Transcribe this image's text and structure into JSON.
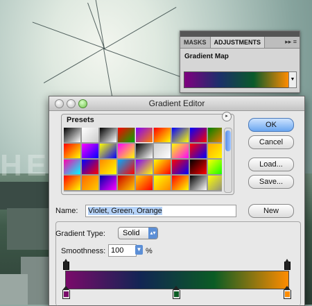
{
  "background": {
    "letters": "HE"
  },
  "adjustments_panel": {
    "tabs": [
      {
        "label": "MASKS",
        "active": false
      },
      {
        "label": "ADJUSTMENTS",
        "active": true
      }
    ],
    "tab_controls": "▸▸ ≡",
    "title": "Gradient Map",
    "gradient": [
      "#800080",
      "#1c2f6b",
      "#0a5a2a",
      "#ff8c00"
    ]
  },
  "dialog": {
    "title": "Gradient Editor",
    "presets": {
      "label": "Presets",
      "swatches": [
        [
          "#000000",
          "#ffffff"
        ],
        [
          "#ffffff",
          "#cccccc"
        ],
        [
          "#000000",
          "#ffffff"
        ],
        [
          "#ff0000",
          "#00aa00"
        ],
        [
          "#8000ff",
          "#ff8000"
        ],
        [
          "#ff0000",
          "#ffff00"
        ],
        [
          "#0000ff",
          "#ffff00"
        ],
        [
          "#0000ff",
          "#ff0000"
        ],
        [
          "#008000",
          "#ff8000"
        ],
        [
          "#ff0000",
          "#ffff00"
        ],
        [
          "#ff00ff",
          "#0000ff"
        ],
        [
          "#ffff00",
          "#0000ff"
        ],
        [
          "#ff00ff",
          "#ffff00"
        ],
        [
          "#000000",
          "#ffffff"
        ],
        [
          "#cccccc",
          "#ffffff"
        ],
        [
          "#ffff00",
          "#ff00ff"
        ],
        [
          "#ff0000",
          "#0000ff"
        ],
        [
          "#ffaa00",
          "#ffff00"
        ],
        [
          "#ff00aa",
          "#00ffff"
        ],
        [
          "#0000ff",
          "#ff0000"
        ],
        [
          "#ff8800",
          "#ffff00"
        ],
        [
          "#00aaff",
          "#ff0000"
        ],
        [
          "#8000ff",
          "#ffff00"
        ],
        [
          "#ffff00",
          "#ff0000"
        ],
        [
          "#ff0000",
          "#0000ff"
        ],
        [
          "#000000",
          "#ff0000"
        ],
        [
          "#ffff00",
          "#00ff00"
        ],
        [
          "#ff0000",
          "#ffff00"
        ],
        [
          "#ff6600",
          "#ffcc00"
        ],
        [
          "#0000aa",
          "#ff00ff"
        ],
        [
          "#cc0000",
          "#ffcc00"
        ],
        [
          "#ffcc00",
          "#ff0000"
        ],
        [
          "#ffff00",
          "#ff8800"
        ],
        [
          "#ff0000",
          "#ffff00"
        ],
        [
          "#000000",
          "#ffffff"
        ],
        [
          "#ffff00",
          "#888888"
        ]
      ],
      "menu_icon": "▸"
    },
    "buttons": {
      "ok": "OK",
      "cancel": "Cancel",
      "load": "Load...",
      "save": "Save...",
      "new": "New"
    },
    "name": {
      "label": "Name:",
      "value": "Violet, Green, Orange"
    },
    "gradient_type": {
      "label": "Gradient Type:",
      "value": "Solid"
    },
    "smoothness": {
      "label": "Smoothness:",
      "value": "100",
      "unit": "%"
    },
    "gradient_colors": [
      "#7a0a6a",
      "#122554",
      "#0b5c24",
      "#ff8c00"
    ],
    "color_stops": [
      "#7a0a6a",
      "#0b5c24",
      "#ff8c00"
    ]
  }
}
